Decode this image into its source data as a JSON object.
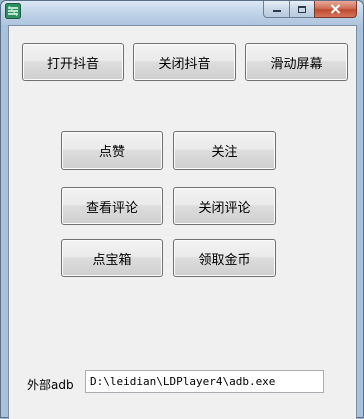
{
  "window": {
    "icon": "app-icon",
    "controls": {
      "minimize_icon": "minimize-icon",
      "maximize_icon": "maximize-icon",
      "close_icon": "close-icon"
    }
  },
  "buttons": {
    "open_douyin": "打开抖音",
    "close_douyin": "关闭抖音",
    "slide_screen": "滑动屏幕",
    "like": "点赞",
    "follow": "关注",
    "view_comments": "查看评论",
    "close_comments": "关闭评论",
    "treasure_box": "点宝箱",
    "collect_coins": "领取金币"
  },
  "adb": {
    "label": "外部adb",
    "path": "D:\\leidian\\LDPlayer4\\adb.exe"
  },
  "colors": {
    "close_button": "#c04b30",
    "client_background": "#f0f0f0"
  }
}
